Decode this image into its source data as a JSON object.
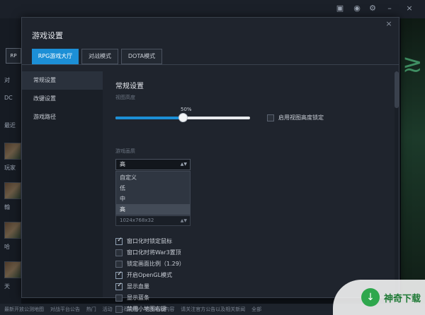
{
  "background": {
    "left_labels": [
      "RP",
      "对",
      "DC",
      "最近",
      "玩家",
      "翰",
      "哈",
      "天"
    ],
    "bottom_text": [
      "最新开放公测地图",
      "对战平台公告",
      "热门",
      "活动",
      "推荐地图",
      "更多精彩内容",
      "请关注官方公告以及相关新闻",
      "全部"
    ]
  },
  "dialog": {
    "title": "游戏设置",
    "close_label": "×",
    "tabs": [
      {
        "label": "RPG游戏大厅",
        "active": true
      },
      {
        "label": "对战模式",
        "active": false
      },
      {
        "label": "DOTA模式",
        "active": false
      }
    ],
    "side_items": [
      {
        "label": "常规设置",
        "active": true
      },
      {
        "label": "改键设置",
        "active": false
      },
      {
        "label": "游戏路径",
        "active": false
      }
    ]
  },
  "general": {
    "section_title": "常规设置",
    "view_height_label": "视图高度",
    "view_height_value": "50%",
    "view_height_fraction": 0.5,
    "view_lock_label": "启用视图高度锁定",
    "view_lock_checked": false,
    "quality_label": "游戏画质",
    "quality_selected": "高",
    "quality_options": [
      "自定义",
      "低",
      "中",
      "高"
    ],
    "resolution_value": "1024x768x32",
    "checkboxes": [
      {
        "label": "窗口化时锁定鼠标",
        "checked": true
      },
      {
        "label": "窗口化时将War3置顶",
        "checked": false
      },
      {
        "label": "锁定画面比例（1.29）",
        "checked": false
      },
      {
        "label": "开启OpenGL模式",
        "checked": true
      },
      {
        "label": "显示血量",
        "checked": true
      },
      {
        "label": "显示蓝条",
        "checked": false
      },
      {
        "label": "禁用小地图右键",
        "checked": false
      }
    ]
  },
  "watermark": {
    "text": "神奇下载"
  },
  "colors": {
    "accent": "#1c8fd6",
    "dialog_bg": "#1f242d",
    "sidebar_bg": "#1a1f27"
  }
}
